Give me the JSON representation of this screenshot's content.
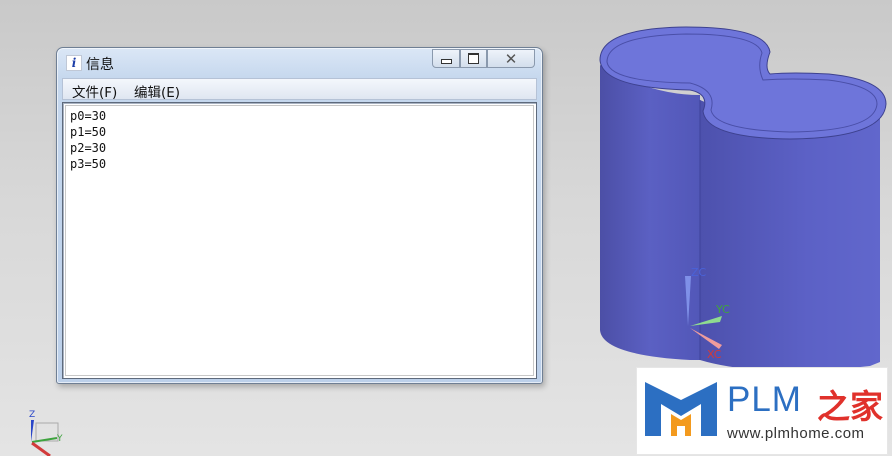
{
  "dialog": {
    "icon": "i",
    "title": "信息",
    "menu": [
      "文件(F)",
      "编辑(E)"
    ],
    "lines": [
      "p0=30",
      "p1=50",
      "p2=30",
      "p3=50"
    ],
    "controls": {
      "close_glyph": "✕"
    }
  },
  "viewport": {
    "triad": {
      "z": "ZC",
      "y": "YC",
      "x": "XC"
    },
    "mini_triad": {
      "z": "Z",
      "y": "Y"
    },
    "colors": {
      "body": "#5a5fc2",
      "top": "#6d74d8",
      "z": "#4a62d8",
      "y": "#3fa33f",
      "x": "#d23a3a"
    }
  },
  "watermark": {
    "name": "PLM",
    "chinese": "之家",
    "url": "www.plmhome.com",
    "icons": [
      "plm-logo-icon"
    ]
  }
}
